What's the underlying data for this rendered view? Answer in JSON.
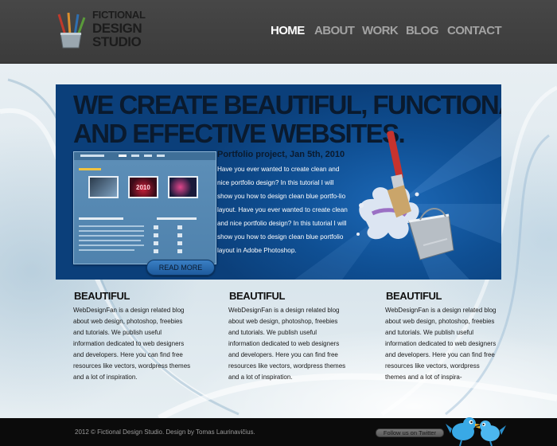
{
  "logo": {
    "line1": "FICTIONAL",
    "line2": "DESIGN",
    "line3": "STUDIO",
    "icon": "brush-cup-icon"
  },
  "nav": {
    "items": [
      {
        "label": "HOME",
        "active": true
      },
      {
        "label": "ABOUT",
        "active": false
      },
      {
        "label": "WORK",
        "active": false
      },
      {
        "label": "BLOG",
        "active": false
      },
      {
        "label": "CONTACT",
        "active": false
      }
    ]
  },
  "hero": {
    "headline_line1": "WE CREATE BEAUTIFUL, FUNCTIONAL",
    "headline_line2": "AND EFFECTIVE WEBSITES.",
    "post_title": "Portfolio project, Jan 5th, 2010",
    "post_body": "Have you ever wanted to create clean and nice portfolio design? In this tutorial I will show you how to design clean blue portfo-lio layout. Have you ever wanted to create clean and nice portfolio design? In this tutorial I will show you how to design clean blue portfolio layout in Adobe Photoshop.",
    "read_more_label": "READ MORE",
    "preview_thumb_text": "2010",
    "illustration": "paint-brush-bucket-icon"
  },
  "columns": [
    {
      "heading": "BEAUTIFUL",
      "text": "WebDesignFan is a design related blog about web design, photoshop, freebies and tutorials. We publish useful information dedicated to web designers and developers. Here you can find free resources like vectors, wordpress themes and a lot of inspiration."
    },
    {
      "heading": "BEAUTIFUL",
      "text": "WebDesignFan is a design related blog about web design, photoshop, freebies and tutorials. We publish useful information dedicated to web designers and developers. Here you can find free resources like vectors, wordpress themes and a lot of inspiration."
    },
    {
      "heading": "BEAUTIFUL",
      "text": "WebDesignFan is a design related blog about web design, photoshop, freebies and tutorials. We publish useful information dedicated to web designers and developers. Here you can find free resources like vectors, wordpress themes and a lot of inspira-"
    }
  ],
  "footer": {
    "copyright": "2012 © Fictional Design Studio. Design by Tomas Laurinavičius.",
    "follow_label": "Follow us on Twitter",
    "birds": "twitter-birds-icon"
  },
  "colors": {
    "header_bg": "#444444",
    "nav_active": "#ffffff",
    "nav_inactive": "#a3a3a3",
    "hero_bg": "#0f4f93",
    "footer_bg": "#0b0b0b"
  }
}
